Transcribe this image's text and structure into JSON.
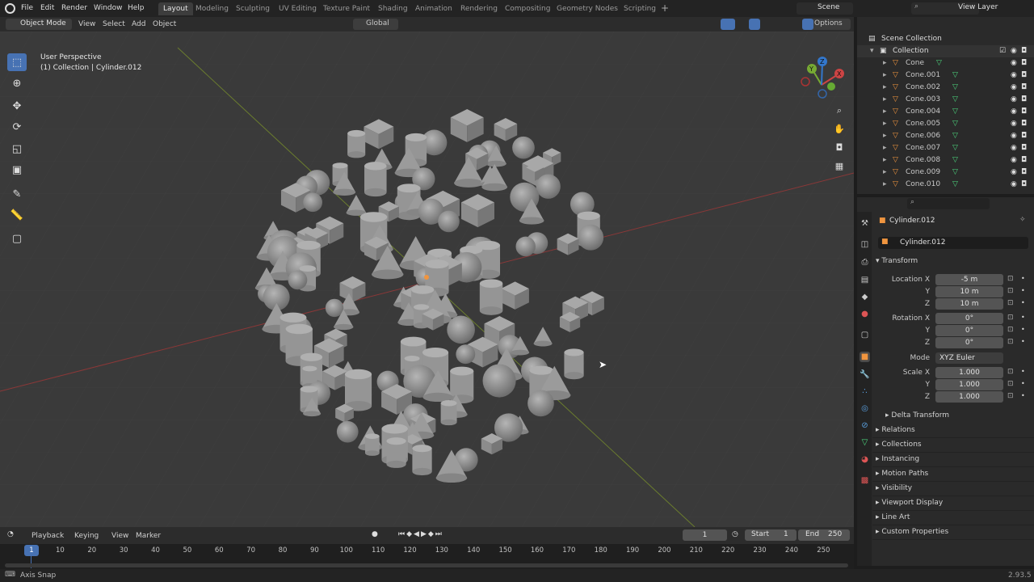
{
  "topbar": {
    "menus": [
      "File",
      "Edit",
      "Render",
      "Window",
      "Help"
    ],
    "workspaces": [
      {
        "label": "Layout",
        "active": true
      },
      {
        "label": "Modeling",
        "active": false
      },
      {
        "label": "Sculpting",
        "active": false
      },
      {
        "label": "UV Editing",
        "active": false
      },
      {
        "label": "Texture Paint",
        "active": false
      },
      {
        "label": "Shading",
        "active": false
      },
      {
        "label": "Animation",
        "active": false
      },
      {
        "label": "Rendering",
        "active": false
      },
      {
        "label": "Compositing",
        "active": false
      },
      {
        "label": "Geometry Nodes",
        "active": false
      },
      {
        "label": "Scripting",
        "active": false
      }
    ],
    "scene": "Scene",
    "view_layer": "View Layer"
  },
  "viewport_header": {
    "mode": "Object Mode",
    "menus": [
      "View",
      "Select",
      "Add",
      "Object"
    ],
    "orientation": "Global",
    "options": "Options"
  },
  "viewport": {
    "perspective": "User Perspective",
    "collection_info": "(1) Collection | Cylinder.012",
    "gizmo": {
      "x": "X",
      "y": "Y",
      "z": "Z"
    },
    "tools": [
      "select-box",
      "cursor",
      "move",
      "rotate",
      "scale",
      "transform",
      "annotate",
      "measure",
      "add-cube"
    ]
  },
  "outliner": {
    "root": "Scene Collection",
    "collection": "Collection",
    "items": [
      "Cone",
      "Cone.001",
      "Cone.002",
      "Cone.003",
      "Cone.004",
      "Cone.005",
      "Cone.006",
      "Cone.007",
      "Cone.008",
      "Cone.009",
      "Cone.010"
    ]
  },
  "properties": {
    "object_name": "Cylinder.012",
    "data_name": "Cylinder.012",
    "section_transform": "Transform",
    "location": {
      "label": "Location X",
      "x": "-5 m",
      "y": "10 m",
      "z": "10 m"
    },
    "rotation": {
      "label": "Rotation X",
      "x": "0°",
      "y": "0°",
      "z": "0°"
    },
    "mode": {
      "label": "Mode",
      "value": "XYZ Euler"
    },
    "scale": {
      "label": "Scale X",
      "x": "1.000",
      "y": "1.000",
      "z": "1.000"
    },
    "axis_y": "Y",
    "axis_z": "Z",
    "delta": "Delta Transform",
    "sections": [
      "Relations",
      "Collections",
      "Instancing",
      "Motion Paths",
      "Visibility",
      "Viewport Display",
      "Line Art",
      "Custom Properties"
    ]
  },
  "timeline": {
    "menus": [
      "Playback",
      "Keying",
      "View",
      "Marker"
    ],
    "current_frame": "1",
    "start_label": "Start",
    "start": "1",
    "end_label": "End",
    "end": "250",
    "ruler": [
      "1",
      "10",
      "20",
      "30",
      "40",
      "50",
      "60",
      "70",
      "80",
      "90",
      "100",
      "110",
      "120",
      "130",
      "140",
      "150",
      "160",
      "170",
      "180",
      "190",
      "200",
      "210",
      "220",
      "230",
      "240",
      "250"
    ]
  },
  "status": {
    "left": "Axis Snap",
    "version": "2.93.5"
  }
}
